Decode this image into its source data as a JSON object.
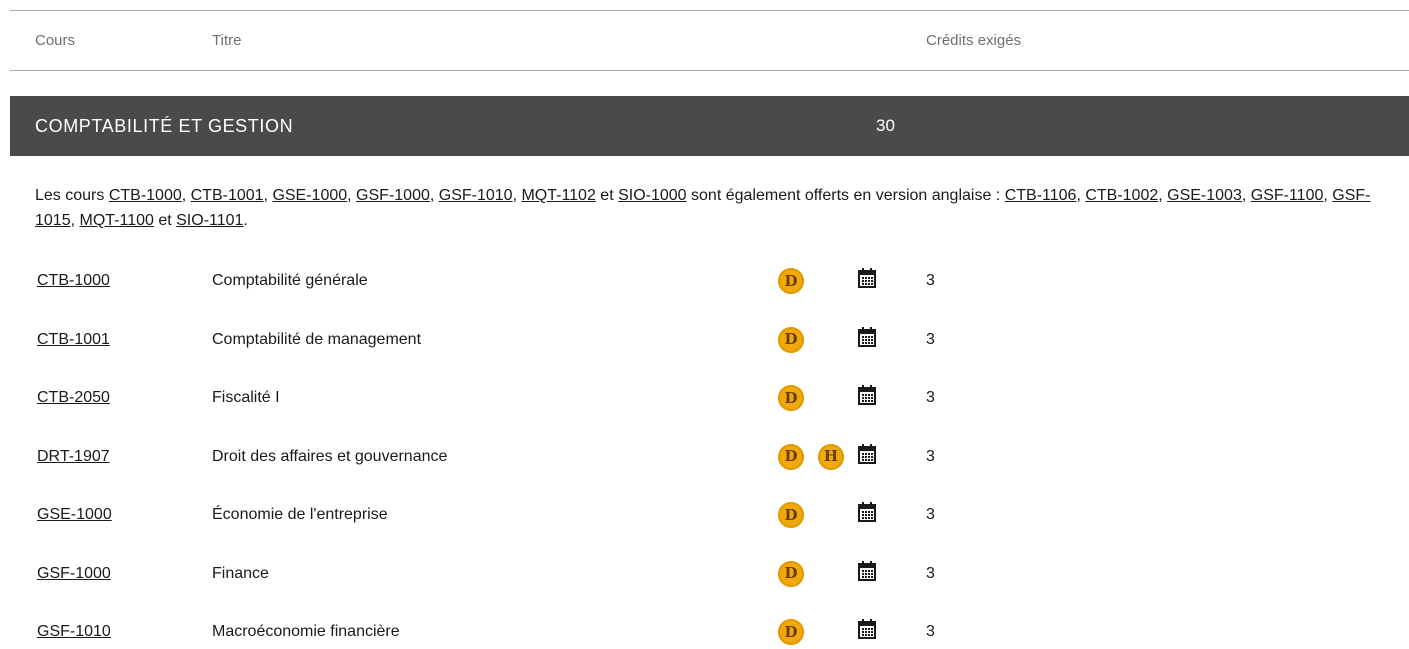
{
  "header": {
    "col_course": "Cours",
    "col_title": "Titre",
    "col_credits": "Crédits exigés"
  },
  "section": {
    "name": "COMPTABILITÉ ET GESTION",
    "credits": "30"
  },
  "note": {
    "p1": "Les cours ",
    "fr_codes": [
      "CTB-1000",
      "CTB-1001",
      "GSE-1000",
      "GSF-1000",
      "GSF-1010",
      "MQT-1102",
      "SIO-1000"
    ],
    "sep": ", ",
    "and": " et ",
    "p2": " sont également offerts en version anglaise : ",
    "en_codes": [
      "CTB-1106",
      "CTB-1002",
      "GSE-1003",
      "GSF-1100",
      "GSF-1015",
      "MQT-1100",
      "SIO-1101"
    ],
    "end": "."
  },
  "badge_labels": {
    "D": "D",
    "H": "H"
  },
  "colors": {
    "section_bg": "#4a4a4a",
    "badge": "#f0a90a",
    "badge_text": "#6b3a00"
  },
  "icons": {
    "mode_badge": "mode-badge",
    "schedule": "calendar-icon"
  },
  "courses": [
    {
      "code": "CTB-1000",
      "title": "Comptabilité générale",
      "modes": [
        "D"
      ],
      "credits": "3"
    },
    {
      "code": "CTB-1001",
      "title": "Comptabilité de management",
      "modes": [
        "D"
      ],
      "credits": "3"
    },
    {
      "code": "CTB-2050",
      "title": "Fiscalité I",
      "modes": [
        "D"
      ],
      "credits": "3"
    },
    {
      "code": "DRT-1907",
      "title": "Droit des affaires et gouvernance",
      "modes": [
        "D",
        "H"
      ],
      "credits": "3"
    },
    {
      "code": "GSE-1000",
      "title": "Économie de l'entreprise",
      "modes": [
        "D"
      ],
      "credits": "3"
    },
    {
      "code": "GSF-1000",
      "title": "Finance",
      "modes": [
        "D"
      ],
      "credits": "3"
    },
    {
      "code": "GSF-1010",
      "title": "Macroéconomie financière",
      "modes": [
        "D"
      ],
      "credits": "3"
    }
  ]
}
